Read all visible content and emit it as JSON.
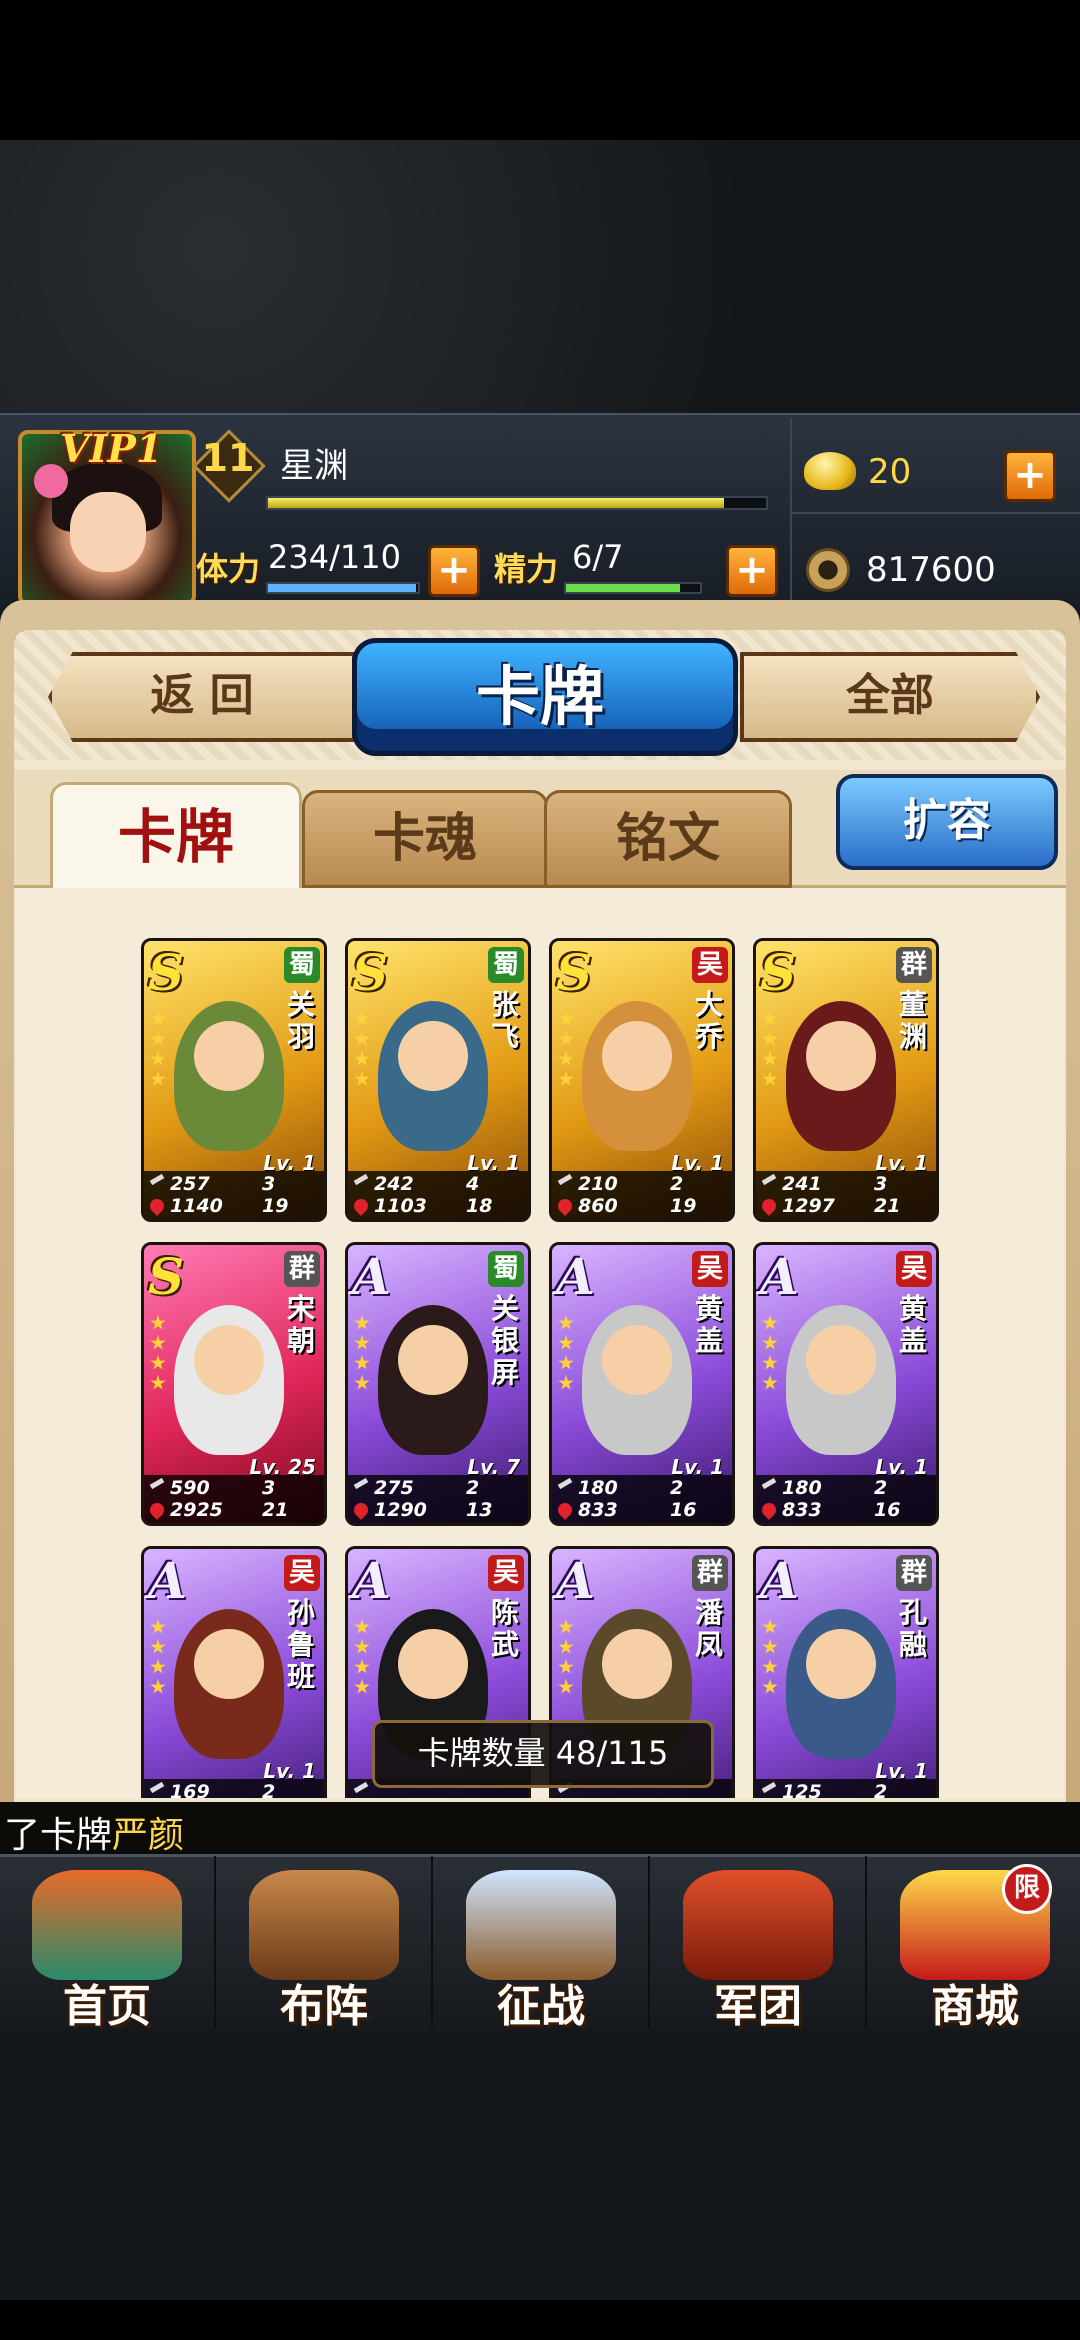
{
  "header": {
    "vip_label": "VIP1",
    "level": "11",
    "player_name": "星渊",
    "stamina_label": "体力",
    "stamina_value": "234/110",
    "spirit_label": "精力",
    "spirit_value": "6/7",
    "gold": "20",
    "coins": "817600",
    "exp_progress": 0.92
  },
  "nav": {
    "back_label": "返 回",
    "title": "卡牌",
    "all_label": "全部"
  },
  "tabs": {
    "cards": "卡牌",
    "souls": "卡魂",
    "runes": "铭文",
    "expand": "扩容"
  },
  "cards": [
    {
      "rank": "S",
      "faction": "蜀",
      "name": "关羽",
      "level": "Lv. 1",
      "atk": "257",
      "n1": "3",
      "hp": "1140",
      "n2": "19"
    },
    {
      "rank": "S",
      "faction": "蜀",
      "name": "张飞",
      "level": "Lv. 1",
      "atk": "242",
      "n1": "4",
      "hp": "1103",
      "n2": "18"
    },
    {
      "rank": "S",
      "faction": "吴",
      "name": "大乔",
      "level": "Lv. 1",
      "atk": "210",
      "n1": "2",
      "hp": "860",
      "n2": "19"
    },
    {
      "rank": "S",
      "faction": "群",
      "name": "董渊",
      "level": "Lv. 1",
      "atk": "241",
      "n1": "3",
      "hp": "1297",
      "n2": "21"
    },
    {
      "rank": "S",
      "faction": "群",
      "name": "宋朝",
      "level": "Lv. 25",
      "atk": "590",
      "n1": "3",
      "hp": "2925",
      "n2": "21"
    },
    {
      "rank": "A",
      "faction": "蜀",
      "name": "关银屏",
      "level": "Lv. 7",
      "atk": "275",
      "n1": "2",
      "hp": "1290",
      "n2": "13"
    },
    {
      "rank": "A",
      "faction": "吴",
      "name": "黄盖",
      "level": "Lv. 1",
      "atk": "180",
      "n1": "2",
      "hp": "833",
      "n2": "16"
    },
    {
      "rank": "A",
      "faction": "吴",
      "name": "黄盖",
      "level": "Lv. 1",
      "atk": "180",
      "n1": "2",
      "hp": "833",
      "n2": "16"
    },
    {
      "rank": "A",
      "faction": "吴",
      "name": "孙鲁班",
      "level": "Lv. 1",
      "atk": "169",
      "n1": "2",
      "hp": "",
      "n2": ""
    },
    {
      "rank": "A",
      "faction": "吴",
      "name": "陈武",
      "level": "",
      "atk": "",
      "n1": "",
      "hp": "",
      "n2": ""
    },
    {
      "rank": "A",
      "faction": "群",
      "name": "潘凤",
      "level": "",
      "atk": "",
      "n1": "",
      "hp": "",
      "n2": ""
    },
    {
      "rank": "A",
      "faction": "群",
      "name": "孔融",
      "level": "Lv. 1",
      "atk": "125",
      "n1": "2",
      "hp": "",
      "n2": ""
    }
  ],
  "card_count": "卡牌数量 48/115",
  "ticker": {
    "prefix": "了卡牌",
    "highlight": "严颜"
  },
  "bottom_nav": [
    {
      "label": "首页",
      "icon": "home-icon"
    },
    {
      "label": "布阵",
      "icon": "formation-icon"
    },
    {
      "label": "征战",
      "icon": "battle-icon"
    },
    {
      "label": "军团",
      "icon": "legion-icon"
    },
    {
      "label": "商城",
      "icon": "shop-icon",
      "badge": "限"
    }
  ],
  "colors": {
    "gold_text": "#ffd84a",
    "title_blue": "#1a6ed8",
    "active_tab_text": "#a01010",
    "shu": "#2a8a2a",
    "wu": "#c41a1a",
    "qun": "#555555"
  }
}
